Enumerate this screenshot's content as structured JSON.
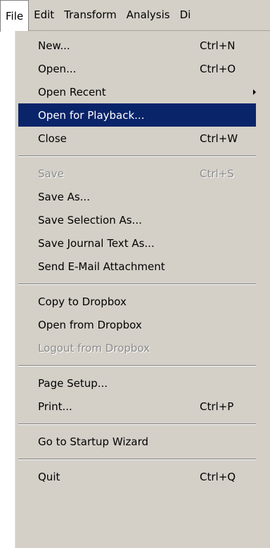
{
  "menubar": {
    "items": [
      "File",
      "Edit",
      "Transform",
      "Analysis",
      "Di"
    ]
  },
  "file_menu": {
    "items": [
      {
        "label": "New...",
        "shortcut": "Ctrl+N"
      },
      {
        "label": "Open...",
        "shortcut": "Ctrl+O"
      },
      {
        "label": "Open Recent",
        "shortcut": ""
      },
      {
        "label": "Open for Playback...",
        "shortcut": ""
      },
      {
        "label": "Close",
        "shortcut": "Ctrl+W"
      },
      {
        "label": "Save",
        "shortcut": "Ctrl+S"
      },
      {
        "label": "Save As...",
        "shortcut": ""
      },
      {
        "label": "Save Selection As...",
        "shortcut": ""
      },
      {
        "label": "Save Journal Text As...",
        "shortcut": ""
      },
      {
        "label": "Send E-Mail Attachment",
        "shortcut": ""
      },
      {
        "label": "Copy to Dropbox",
        "shortcut": ""
      },
      {
        "label": "Open from Dropbox",
        "shortcut": ""
      },
      {
        "label": "Logout from Dropbox",
        "shortcut": ""
      },
      {
        "label": "Page Setup...",
        "shortcut": ""
      },
      {
        "label": "Print...",
        "shortcut": "Ctrl+P"
      },
      {
        "label": "Go to Startup Wizard",
        "shortcut": ""
      },
      {
        "label": "Quit",
        "shortcut": "Ctrl+Q"
      }
    ]
  },
  "colors": {
    "menu_background": "#d4d0c8",
    "highlight_background": "#0a246a",
    "highlight_text": "#ffffff",
    "disabled_text": "#8b8b8b"
  },
  "icons": {
    "submenu": "submenu-arrow-icon"
  }
}
